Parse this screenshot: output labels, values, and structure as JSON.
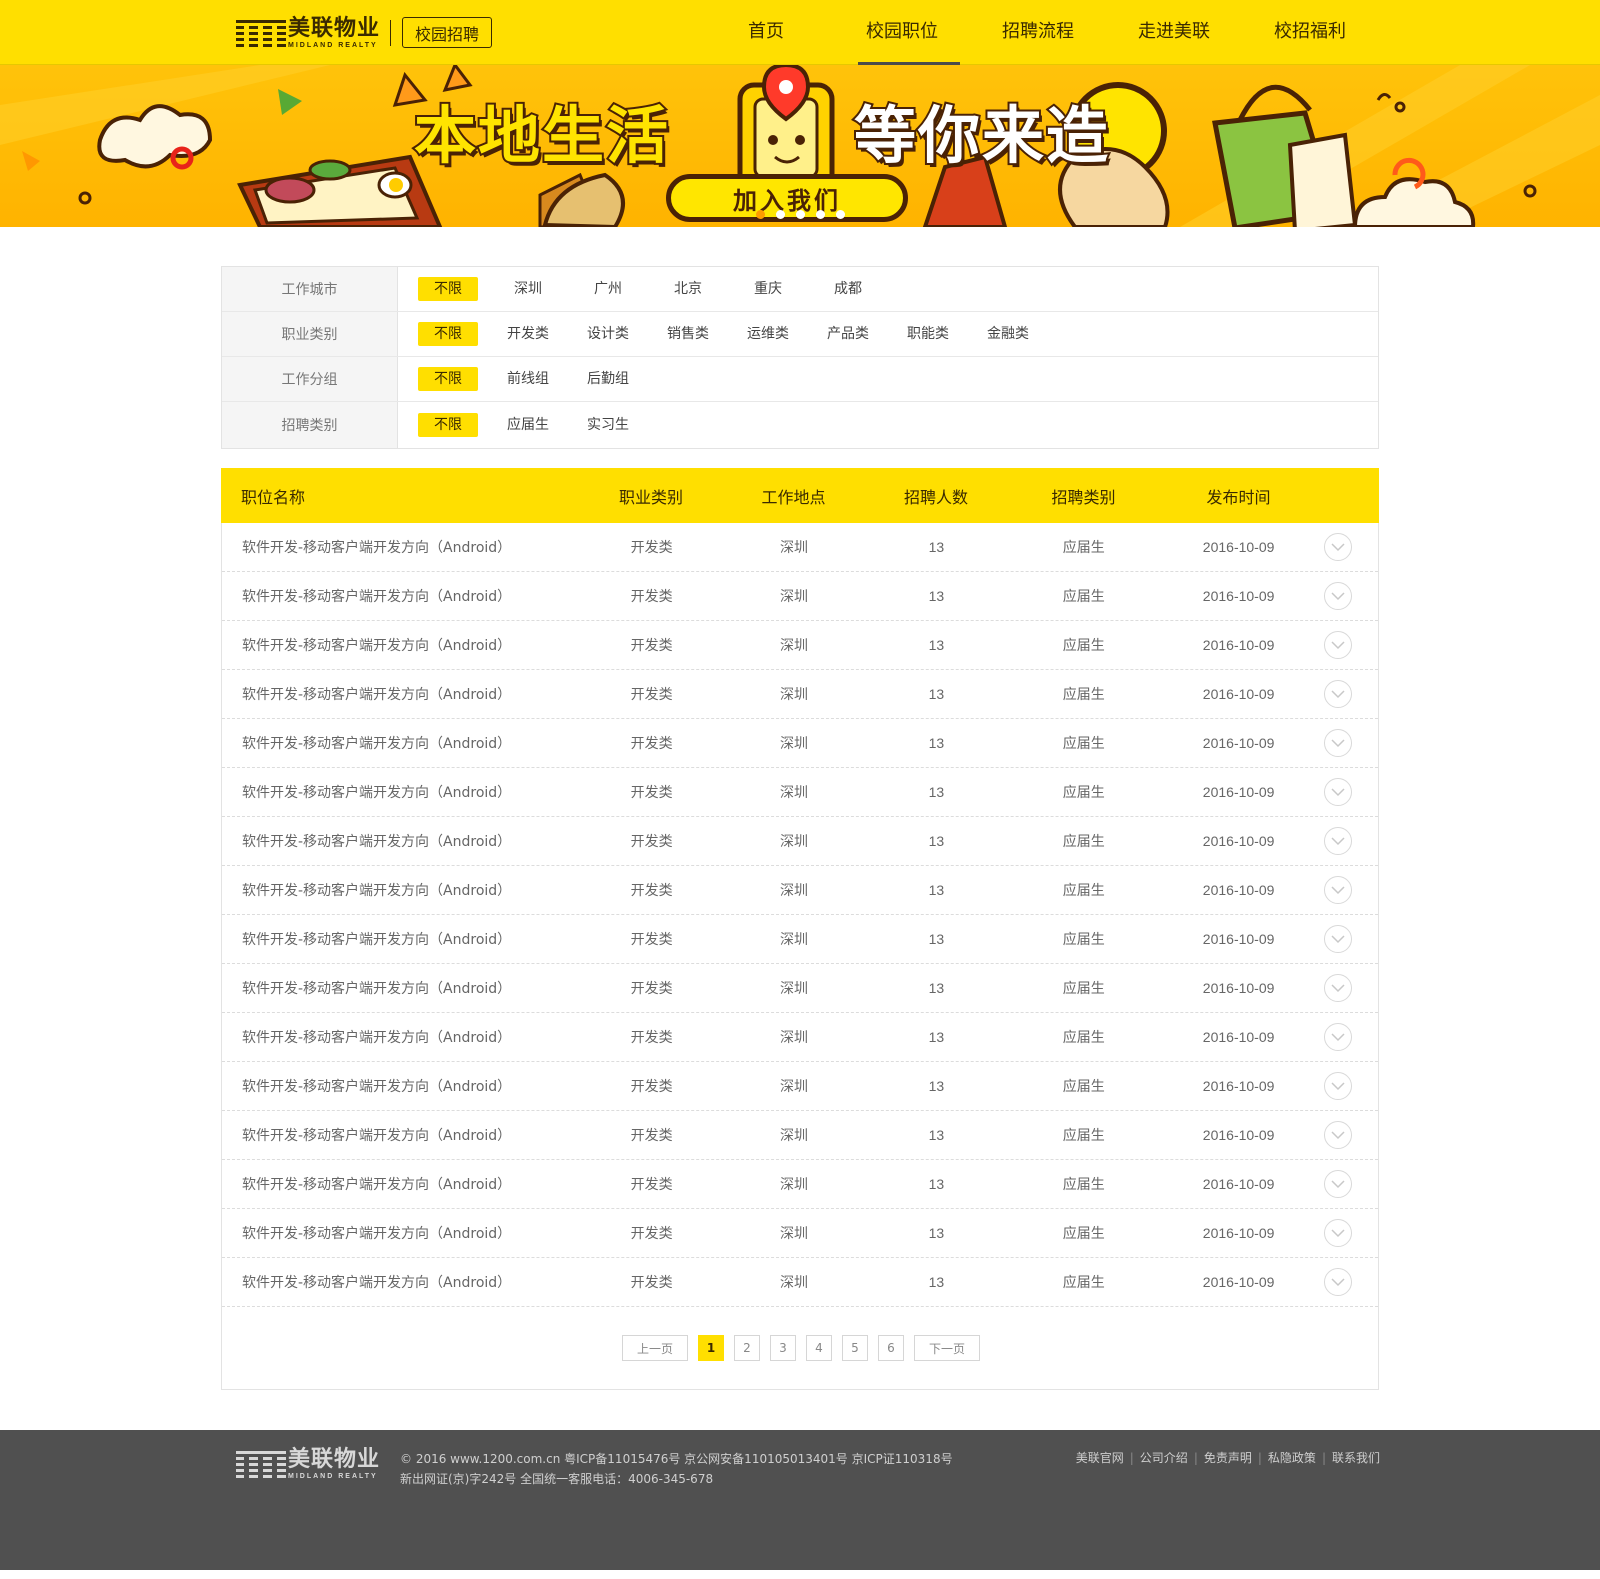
{
  "header": {
    "logo_cn": "美联物业",
    "logo_en": "MIDLAND REALTY",
    "campus_tag": "校园招聘",
    "nav": [
      {
        "label": "首页",
        "active": false
      },
      {
        "label": "校园职位",
        "active": true
      },
      {
        "label": "招聘流程",
        "active": false
      },
      {
        "label": "走进美联",
        "active": false
      },
      {
        "label": "校招福利",
        "active": false
      }
    ]
  },
  "banner": {
    "title_left": "本地生活",
    "title_right": "等你来造",
    "button_label": "加入我们",
    "slides": 5,
    "active_slide": 0
  },
  "filters": [
    {
      "label": "工作城市",
      "options": [
        "不限",
        "深圳",
        "广州",
        "北京",
        "重庆",
        "成都"
      ],
      "active": 0
    },
    {
      "label": "职业类别",
      "options": [
        "不限",
        "开发类",
        "设计类",
        "销售类",
        "运维类",
        "产品类",
        "职能类",
        "金融类"
      ],
      "active": 0
    },
    {
      "label": "工作分组",
      "options": [
        "不限",
        "前线组",
        "后勤组"
      ],
      "active": 0
    },
    {
      "label": "招聘类别",
      "options": [
        "不限",
        "应届生",
        "实习生"
      ],
      "active": 0
    }
  ],
  "table": {
    "headers": {
      "name": "职位名称",
      "category": "职业类别",
      "location": "工作地点",
      "count": "招聘人数",
      "type": "招聘类别",
      "date": "发布时间"
    },
    "rows": [
      {
        "name": "软件开发-移动客户端开发方向（Android）",
        "category": "开发类",
        "location": "深圳",
        "count": "13",
        "type": "应届生",
        "date": "2016-10-09"
      },
      {
        "name": "软件开发-移动客户端开发方向（Android）",
        "category": "开发类",
        "location": "深圳",
        "count": "13",
        "type": "应届生",
        "date": "2016-10-09"
      },
      {
        "name": "软件开发-移动客户端开发方向（Android）",
        "category": "开发类",
        "location": "深圳",
        "count": "13",
        "type": "应届生",
        "date": "2016-10-09"
      },
      {
        "name": "软件开发-移动客户端开发方向（Android）",
        "category": "开发类",
        "location": "深圳",
        "count": "13",
        "type": "应届生",
        "date": "2016-10-09"
      },
      {
        "name": "软件开发-移动客户端开发方向（Android）",
        "category": "开发类",
        "location": "深圳",
        "count": "13",
        "type": "应届生",
        "date": "2016-10-09"
      },
      {
        "name": "软件开发-移动客户端开发方向（Android）",
        "category": "开发类",
        "location": "深圳",
        "count": "13",
        "type": "应届生",
        "date": "2016-10-09"
      },
      {
        "name": "软件开发-移动客户端开发方向（Android）",
        "category": "开发类",
        "location": "深圳",
        "count": "13",
        "type": "应届生",
        "date": "2016-10-09"
      },
      {
        "name": "软件开发-移动客户端开发方向（Android）",
        "category": "开发类",
        "location": "深圳",
        "count": "13",
        "type": "应届生",
        "date": "2016-10-09"
      },
      {
        "name": "软件开发-移动客户端开发方向（Android）",
        "category": "开发类",
        "location": "深圳",
        "count": "13",
        "type": "应届生",
        "date": "2016-10-09"
      },
      {
        "name": "软件开发-移动客户端开发方向（Android）",
        "category": "开发类",
        "location": "深圳",
        "count": "13",
        "type": "应届生",
        "date": "2016-10-09"
      },
      {
        "name": "软件开发-移动客户端开发方向（Android）",
        "category": "开发类",
        "location": "深圳",
        "count": "13",
        "type": "应届生",
        "date": "2016-10-09"
      },
      {
        "name": "软件开发-移动客户端开发方向（Android）",
        "category": "开发类",
        "location": "深圳",
        "count": "13",
        "type": "应届生",
        "date": "2016-10-09"
      },
      {
        "name": "软件开发-移动客户端开发方向（Android）",
        "category": "开发类",
        "location": "深圳",
        "count": "13",
        "type": "应届生",
        "date": "2016-10-09"
      },
      {
        "name": "软件开发-移动客户端开发方向（Android）",
        "category": "开发类",
        "location": "深圳",
        "count": "13",
        "type": "应届生",
        "date": "2016-10-09"
      },
      {
        "name": "软件开发-移动客户端开发方向（Android）",
        "category": "开发类",
        "location": "深圳",
        "count": "13",
        "type": "应届生",
        "date": "2016-10-09"
      },
      {
        "name": "软件开发-移动客户端开发方向（Android）",
        "category": "开发类",
        "location": "深圳",
        "count": "13",
        "type": "应届生",
        "date": "2016-10-09"
      }
    ]
  },
  "pagination": {
    "prev_label": "上一页",
    "next_label": "下一页",
    "pages": [
      "1",
      "2",
      "3",
      "4",
      "5",
      "6"
    ],
    "current": 0
  },
  "footer": {
    "logo_cn": "美联物业",
    "logo_en": "MIDLAND REALTY",
    "line1": "© 2016 www.1200.com.cn 粤ICP备11015476号 京公网安备110105013401号 京ICP证110318号",
    "line2": "新出网证(京)字242号 全国统一客服电话：4006-345-678",
    "links": [
      "美联官网",
      "公司介绍",
      "免责声明",
      "私隐政策",
      "联系我们"
    ]
  },
  "colors": {
    "brand_yellow": "#ffdf00",
    "dark_brown": "#3a2a00",
    "footer_bg": "#505050"
  }
}
